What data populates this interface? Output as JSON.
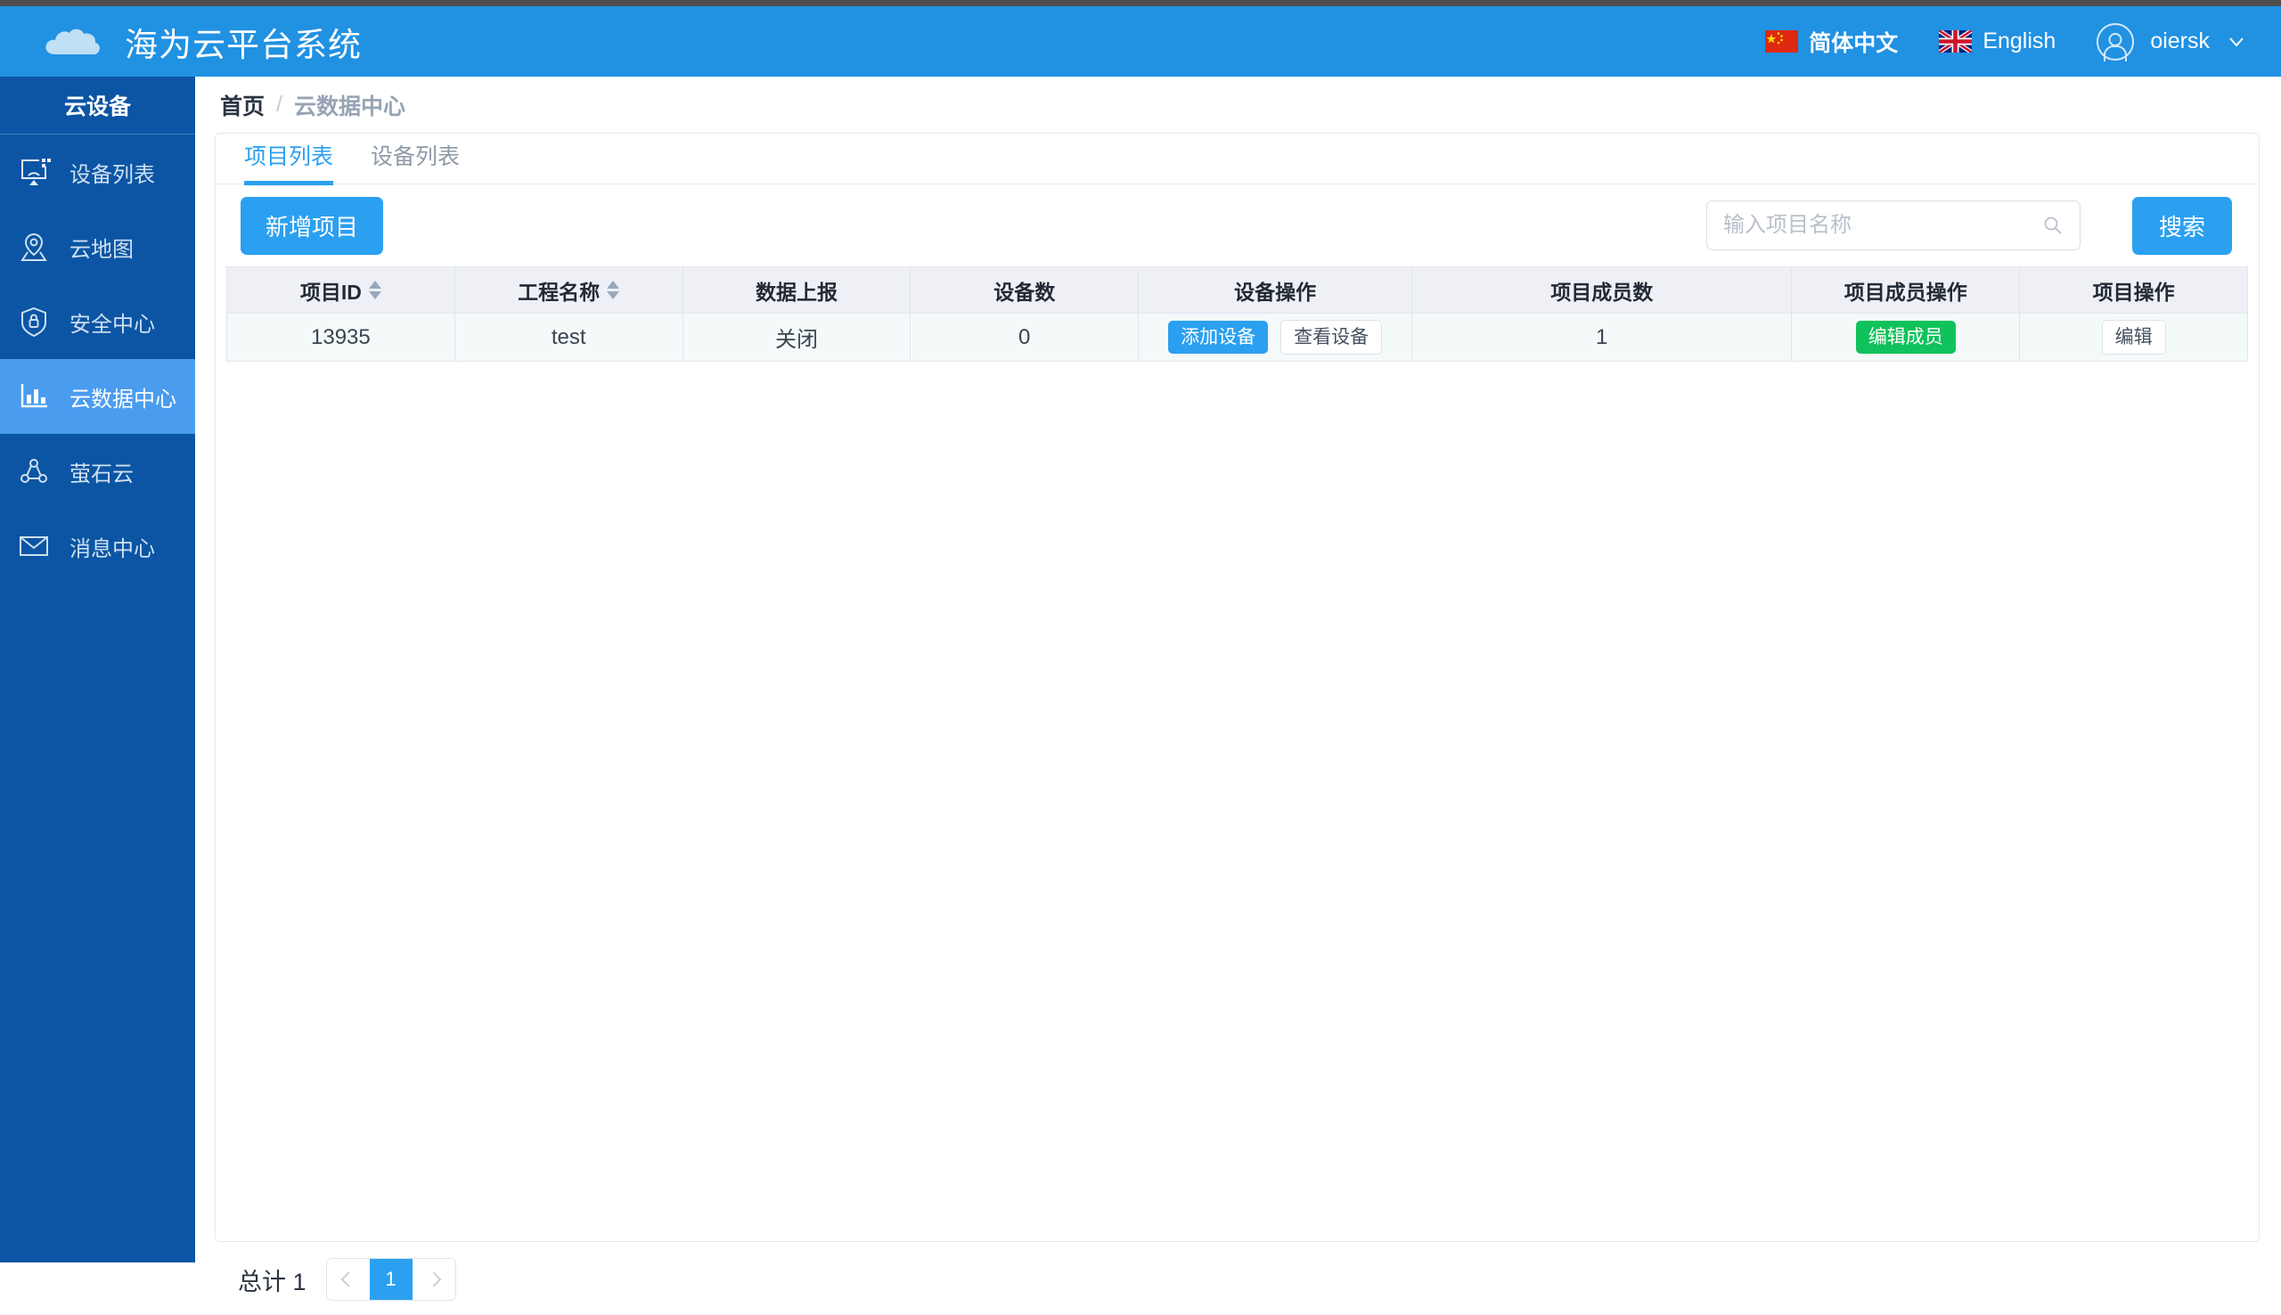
{
  "header": {
    "brand_title": "海为云平台系统",
    "logo_icon": "cloud-icon",
    "lang_cn": "简体中文",
    "lang_en": "English",
    "user_name": "oiersk",
    "avatar_icon": "user-circle-icon",
    "chevron_icon": "chevron-down-icon",
    "accent": "#2191e2"
  },
  "sidebar": {
    "section_title": "云设备",
    "items": [
      {
        "label": "设备列表",
        "icon": "screencast-icon",
        "active": false
      },
      {
        "label": "云地图",
        "icon": "map-pin-icon",
        "active": false
      },
      {
        "label": "安全中心",
        "icon": "shield-lock-icon",
        "active": false
      },
      {
        "label": "云数据中心",
        "icon": "bar-chart-icon",
        "active": true
      },
      {
        "label": "萤石云",
        "icon": "nodes-icon",
        "active": false
      },
      {
        "label": "消息中心",
        "icon": "envelope-icon",
        "active": false
      }
    ],
    "bg": "#0b55a4",
    "active_bg": "#4a9cef"
  },
  "breadcrumb": {
    "home": "首页",
    "separator": "/",
    "current": "云数据中心"
  },
  "tabs": [
    {
      "label": "项目列表",
      "active": true
    },
    {
      "label": "设备列表",
      "active": false
    }
  ],
  "toolbar": {
    "new_project_label": "新增项目",
    "search_placeholder": "输入项目名称",
    "search_value": "",
    "search_button_label": "搜索",
    "search_icon": "search-icon"
  },
  "table": {
    "columns": [
      {
        "label": "项目ID",
        "sortable": true,
        "width": "7.5%"
      },
      {
        "label": "工程名称",
        "sortable": true,
        "width": "7.5%"
      },
      {
        "label": "数据上报",
        "sortable": false,
        "width": "7.5%"
      },
      {
        "label": "设备数",
        "sortable": false,
        "width": "7.5%"
      },
      {
        "label": "设备操作",
        "sortable": false,
        "width": "9%"
      },
      {
        "label": "项目成员数",
        "sortable": false,
        "width": "12.5%"
      },
      {
        "label": "项目成员操作",
        "sortable": false,
        "width": "7.5%"
      },
      {
        "label": "项目操作",
        "sortable": false,
        "width": "7.5%"
      }
    ],
    "rows": [
      {
        "project_id": "13935",
        "project_name": "test",
        "data_report": "关闭",
        "device_count": "0",
        "device_add_label": "添加设备",
        "device_view_label": "查看设备",
        "member_count": "1",
        "member_edit_label": "编辑成员",
        "project_edit_label": "编辑"
      }
    ]
  },
  "pagination": {
    "total_label": "总计 1",
    "prev_icon": "chevron-left-icon",
    "next_icon": "chevron-right-icon",
    "pages": [
      "1"
    ],
    "current_page": "1"
  }
}
